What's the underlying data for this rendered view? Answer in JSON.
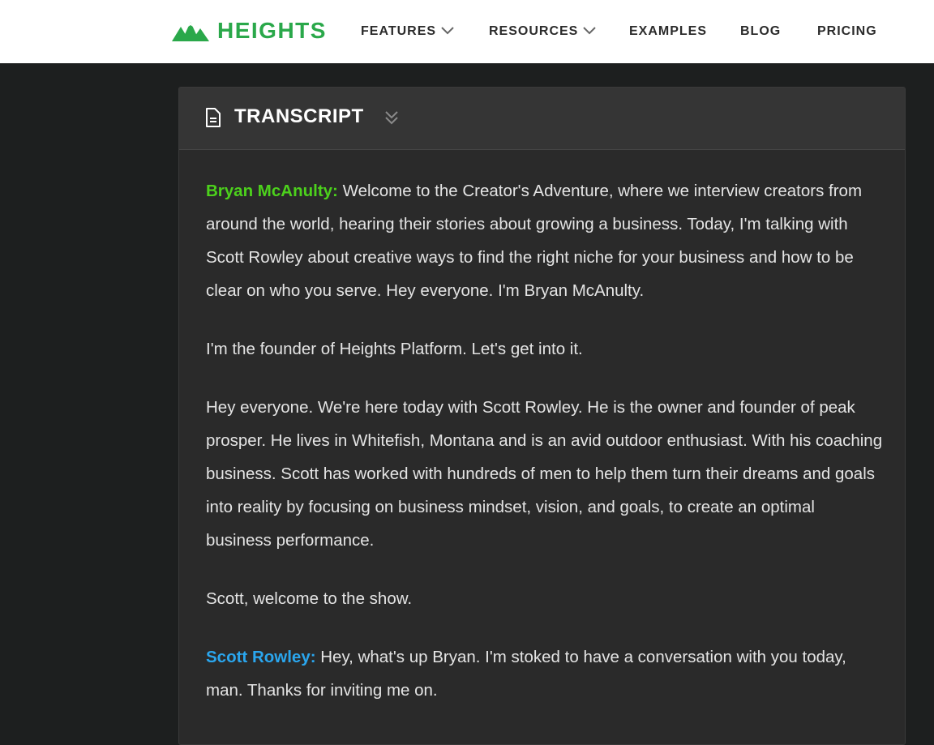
{
  "brand": {
    "name": "HEIGHTS",
    "logo_icon": "mountain-logo-icon",
    "color": "#2aa84a"
  },
  "nav": {
    "features": "FEATURES",
    "resources": "RESOURCES",
    "examples": "EXAMPLES",
    "blog": "BLOG",
    "pricing": "PRICING"
  },
  "transcript": {
    "title": "TRANSCRIPT",
    "icon": "document-icon",
    "toggle_icon": "double-chevron-down-icon",
    "blocks": [
      {
        "speaker": "Bryan McAnulty:",
        "speaker_color": "#4cd11c",
        "text": " Welcome to the Creator's Adventure, where we interview creators from around the world, hearing their stories about growing a business. Today, I'm talking with Scott Rowley about creative ways to find the right niche for your business and how to be clear on who you serve. Hey everyone. I'm Bryan McAnulty."
      },
      {
        "text": "I'm the founder of Heights Platform. Let's get into it."
      },
      {
        "text": "Hey everyone. We're here today with Scott Rowley. He is the owner and founder of peak prosper. He lives in Whitefish, Montana and is an avid outdoor enthusiast. With his coaching business. Scott has worked with hundreds of men to help them turn their dreams and goals into reality by focusing on business mindset, vision, and goals, to create an optimal business performance."
      },
      {
        "text": "Scott, welcome to the show."
      },
      {
        "speaker": "Scott Rowley:",
        "speaker_color": "#2aa6ee",
        "text": " Hey, what's up Bryan. I'm stoked to have a conversation with you today, man. Thanks for inviting me on."
      }
    ]
  }
}
